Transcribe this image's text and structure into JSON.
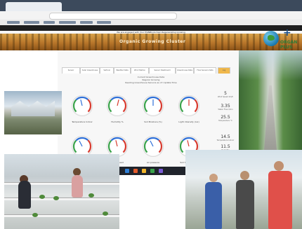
{
  "banner": {
    "notice": "We are engaged with Your PSINBlockchain Regenerating Growing",
    "title": "Organic Growing Cluster"
  },
  "logo": {
    "plus": "+",
    "line1": "ORGAN",
    "line2": "PLUS"
  },
  "dashboard": {
    "tabs": [
      "Sensor Greenhouse",
      "Solar Greenhouse",
      "Vertical",
      "Weather Data",
      "Wind Station",
      "Sensor Dashboard Greenhouse",
      "Greenhouse Data",
      "Flow Sensors Data",
      "Log"
    ],
    "info_lines": [
      "Current Greenhouse Data",
      "Regular Growing",
      "Reading Greenhouse Sensors as of: Update-Time"
    ],
    "gauges": [
      {
        "label": "Temperature Indoor",
        "level": 0.45,
        "color": "#2e6fd8"
      },
      {
        "label": "Humidity %",
        "level": 0.55,
        "color": "#d83a2e"
      },
      {
        "label": "Soil Moisture (%)",
        "level": 0.5,
        "color": "#2e6fd8"
      },
      {
        "label": "Light intensity (lux)",
        "level": 0.5,
        "color": "#d83a2e"
      },
      {
        "label": "CO2 Level",
        "level": 0.4,
        "color": "#2e6fd8"
      },
      {
        "label": "Wind speed",
        "level": 0.45,
        "color": "#d83a2e"
      },
      {
        "label": "Air pressure",
        "level": 0.4,
        "color": "#2e6fd8"
      },
      {
        "label": "Soil temperature",
        "level": 0.45,
        "color": "#d83a2e"
      }
    ],
    "readings": [
      {
        "value": "5",
        "unit": "Wind Speed km/h"
      },
      {
        "value": "3.35",
        "unit": "Water Flow l/min"
      },
      {
        "value": "25.5",
        "unit": "Temperature °C"
      },
      {
        "value": "14.5",
        "unit": "Temperature Indoor"
      },
      {
        "value": "11.5",
        "unit": "Humidity"
      }
    ]
  },
  "colors": {
    "accent_tab": "#f0b84c",
    "banner": "#c98a38",
    "browser_chrome": "#3c4a5c"
  }
}
